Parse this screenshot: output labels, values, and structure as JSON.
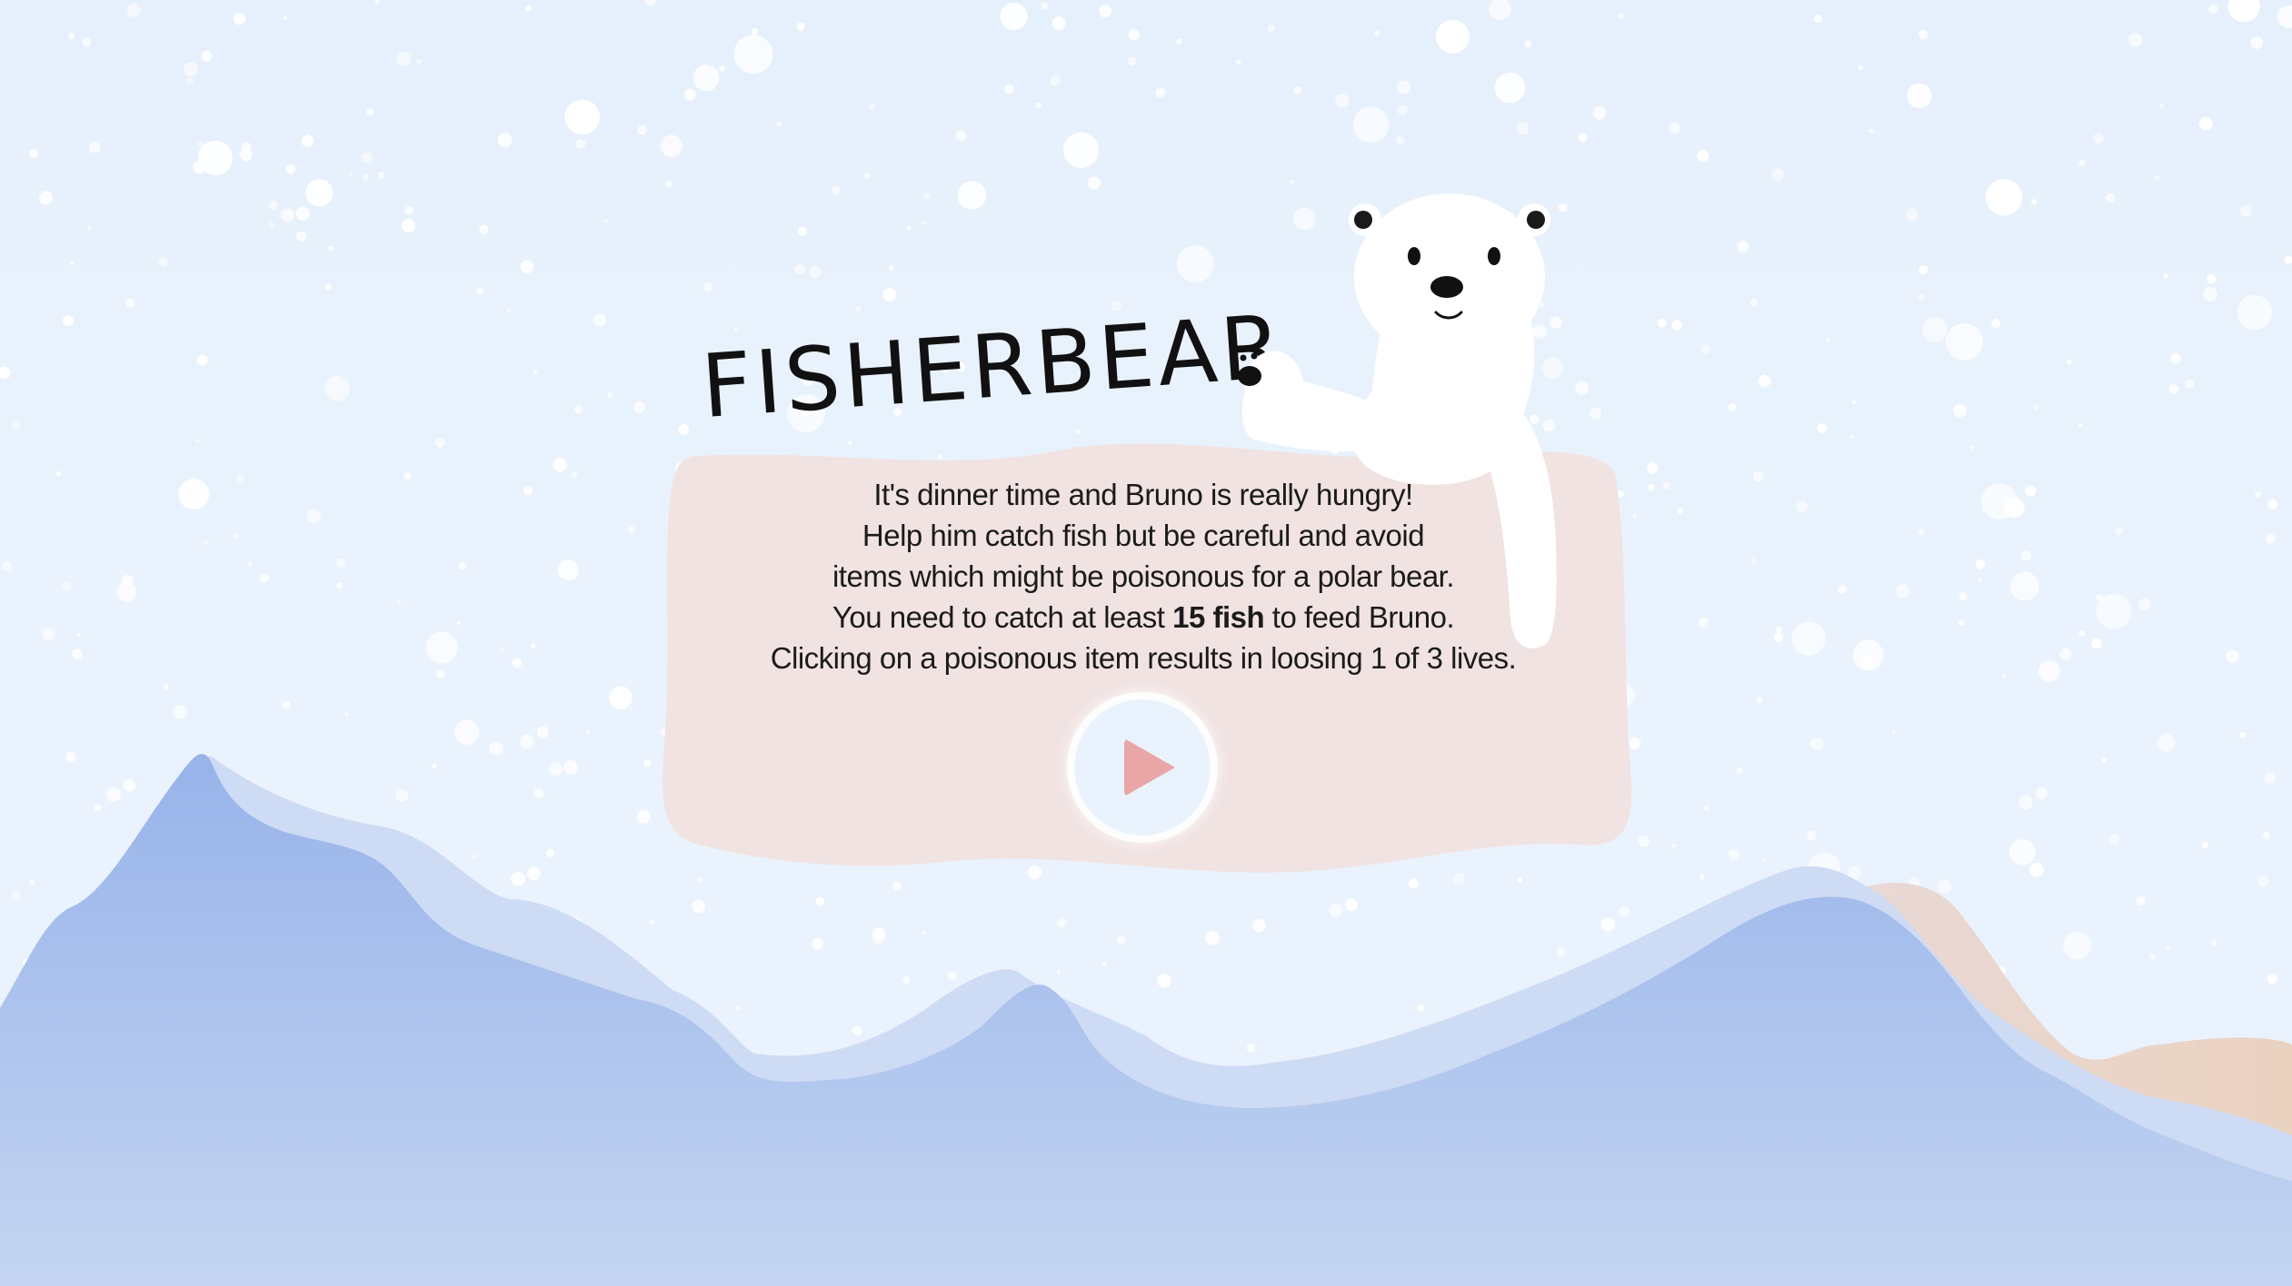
{
  "game": {
    "title": "FISHERBEAR",
    "instructions": {
      "line1": "It's dinner time and Bruno is really hungry!",
      "line2": "Help him catch fish but be careful and avoid",
      "line3": "items which might be poisonous for a polar bear.",
      "line4_before": "You need to catch at least ",
      "line4_bold": "15 fish",
      "line4_after": " to feed Bruno.",
      "line5": "Clicking on a poisonous item results in loosing 1 of 3 lives."
    },
    "play_button": {
      "icon": "play-icon",
      "color": "#e8a6a6"
    },
    "character": "polar-bear"
  },
  "colors": {
    "sky": "#e8f1fc",
    "panel": "#f1e3e3",
    "mountain_front": "#a9c0ec",
    "mountain_back": "#cfdcf4",
    "mountain_peach": "#ebd6cc"
  }
}
